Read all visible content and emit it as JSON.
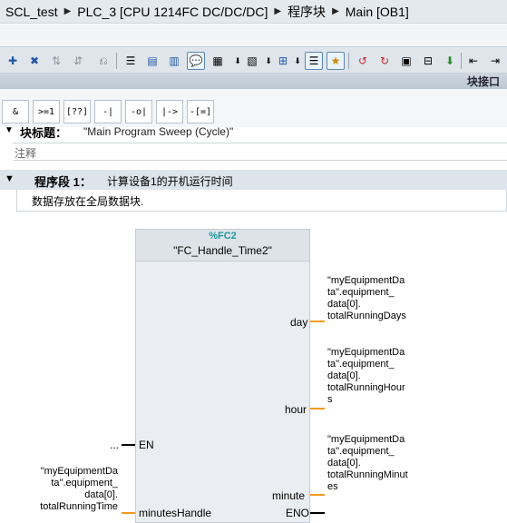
{
  "breadcrumb": {
    "items": [
      "SCL_test",
      "PLC_3 [CPU 1214FC DC/DC/DC]",
      "程序块",
      "Main [OB1]"
    ]
  },
  "toolbar": {
    "icons": [
      "insert-network-icon",
      "delete-network-icon",
      "insert-row-icon",
      "add-row-icon",
      "reset-icon",
      "absolute-operands-icon",
      "display-favorites-icon",
      "network-comments-icon",
      "display-tags-icon",
      "symbol-info-icon",
      "tag-info-icon",
      "sort-icon",
      "open-all-networks-icon",
      "close-all-networks-icon",
      "view-icon",
      "go-online-icon",
      "monitor-icon",
      "load-icon",
      "download-icon",
      "compile-icon",
      "modify-icon",
      "break-icon"
    ]
  },
  "panel": {
    "label": "块接口"
  },
  "instructions": {
    "items": [
      "&",
      ">=1",
      "[??]",
      "-|",
      "-o|",
      "|->",
      "-[=]"
    ]
  },
  "block": {
    "title_label": "块标题：",
    "title_value": "\"Main Program Sweep (Cycle)\"",
    "comment_placeholder": "注释"
  },
  "network": {
    "label": "程序段 1：",
    "title": "计算设备1的开机运行时间",
    "comment": "数据存放在全局数据块."
  },
  "fc": {
    "number": "%FC2",
    "name": "\"FC_Handle_Time2\"",
    "inputs": {
      "en": "EN",
      "en_operand": "...",
      "minutes_handle": "minutesHandle",
      "minutes_handle_tag": [
        "\"myEquipmentDa",
        "ta\".equipment_",
        "data[0].",
        "totalRunningTime"
      ]
    },
    "outputs": {
      "day": "day",
      "day_tag": [
        "\"myEquipmentDa",
        "ta\".equipment_",
        "data[0].",
        "totalRunningDays"
      ],
      "hour": "hour",
      "hour_tag": [
        "\"myEquipmentDa",
        "ta\".equipment_",
        "data[0].",
        "totalRunningHour",
        "s"
      ],
      "minute": "minute",
      "minute_tag": [
        "\"myEquipmentDa",
        "ta\".equipment_",
        "data[0].",
        "totalRunningMinut",
        "es"
      ],
      "eno": "ENO"
    }
  },
  "colors": {
    "accent_teal": "#1b9a9a",
    "wire_orange": "#f39a1f",
    "toolbar_bg": "#dfe5eb"
  }
}
